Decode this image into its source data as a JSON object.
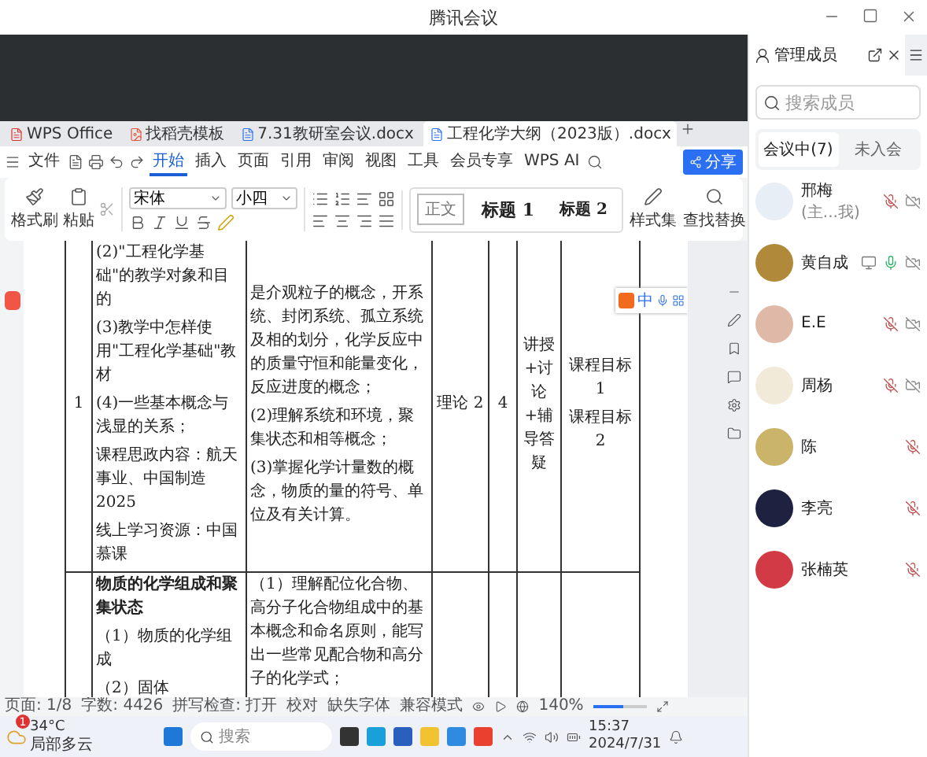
{
  "meeting_window": {
    "title": "腾讯会议"
  },
  "shared_screen": {
    "wps_tabs": [
      {
        "label": "WPS Office",
        "kind": "home",
        "selected": false
      },
      {
        "label": "找稻壳模板",
        "kind": "template",
        "selected": false
      },
      {
        "label": "7.31教研室会议.docx",
        "kind": "doc",
        "selected": false
      },
      {
        "label": "工程化学大纲（2023版）.docx",
        "kind": "doc",
        "selected": true
      }
    ],
    "file_menu": "文件",
    "menu": [
      {
        "label": "开始",
        "selected": true
      },
      {
        "label": "插入",
        "selected": false
      },
      {
        "label": "页面",
        "selected": false
      },
      {
        "label": "引用",
        "selected": false
      },
      {
        "label": "审阅",
        "selected": false
      },
      {
        "label": "视图",
        "selected": false
      },
      {
        "label": "工具",
        "selected": false
      },
      {
        "label": "会员专享",
        "selected": false
      },
      {
        "label": "WPS AI",
        "selected": false
      }
    ],
    "share_button": "分享",
    "ribbon": {
      "format_painter": "格式刷",
      "paste": "粘贴",
      "font": "宋体",
      "size": "小四",
      "styles": [
        {
          "label": "正文",
          "kind": "body",
          "selected": true
        },
        {
          "label": "标题 1",
          "kind": "h1",
          "selected": false
        },
        {
          "label": "标题 2",
          "kind": "h2",
          "selected": false
        }
      ],
      "style_set": "样式集",
      "find_replace": "查找替换"
    },
    "table": {
      "rows": [
        {
          "cells": [
            {
              "paragraphs": [
                "1"
              ]
            },
            {
              "paragraphs": [
                "(2)\"工程化学基础\"的教学对象和目的",
                "(3)教学中怎样使用\"工程化学基础\"教材",
                "(4)一些基本概念与浅显的关系；",
                "课程思政内容：航天事业、中国制造 2025",
                "线上学习资源：中国慕课"
              ]
            },
            {
              "paragraphs": [
                "是介观粒子的概念，开系统、封闭系统、孤立系统及相的划分，化学反应中的质量守恒和能量变化，反应进度的概念；",
                "(2)理解系统和环境，聚集状态和相等概念；",
                "(3)掌握化学计量数的概念，物质的量的符号、单位及有关计算。"
              ]
            },
            {
              "paragraphs": [
                "理论 2"
              ]
            },
            {
              "paragraphs": [
                "4"
              ]
            },
            {
              "paragraphs": [
                "讲授+讨论+辅导答疑"
              ]
            },
            {
              "paragraphs": [
                "课程目标1",
                "课程目标2"
              ]
            }
          ]
        },
        {
          "cells": [
            {},
            {
              "heading": "物质的化学组成和聚集状态",
              "paragraphs": [
                "（1）物质的化学组成",
                "（2）固体"
              ]
            },
            {
              "paragraphs": [
                "（1）理解配位化合物、高分子化合物组成中的基本概念和命名原则，能写出一些常见配合物和高分子的化学式；"
              ]
            },
            {},
            {},
            {},
            {}
          ]
        }
      ]
    },
    "ime_toolbar": {
      "label": "中"
    },
    "status_bar": {
      "items": [
        "页面: 1/8",
        "字数: 4426",
        "拼写检查: 打开",
        "校对",
        "缺失字体",
        "兼容模式"
      ],
      "zoom": "140%",
      "level": 0.55
    }
  },
  "taskbar": {
    "weather_badge": "1",
    "temperature": "34°C",
    "weather": "局部多云",
    "search_placeholder": "搜索",
    "time": "15:37",
    "date": "2024/7/31"
  },
  "members_panel": {
    "title": "管理成员",
    "search_placeholder": "搜索成员",
    "tabs": [
      {
        "label": "会议中(7)",
        "selected": true
      },
      {
        "label": "未入会",
        "selected": false
      }
    ],
    "members": [
      {
        "name": "邢梅",
        "note": "(主...我)",
        "color": "#e8eef6",
        "muted": true,
        "video_off": true,
        "sharing": false
      },
      {
        "name": "黄自成",
        "color": "#b08a3a",
        "muted": false,
        "video_off": true,
        "sharing": true
      },
      {
        "name": "E.E",
        "color": "#e0b8a8",
        "muted": true,
        "video_off": true,
        "sharing": false
      },
      {
        "name": "周杨",
        "color": "#f1ead8",
        "muted": true,
        "video_off": true,
        "sharing": false
      },
      {
        "name": "陈",
        "color": "#c9b46a",
        "muted": true,
        "video_off": false,
        "sharing": false
      },
      {
        "name": "李亮",
        "color": "#1e2240",
        "muted": true,
        "video_off": false,
        "sharing": false
      },
      {
        "name": "张楠英",
        "color": "#d23a45",
        "muted": true,
        "video_off": false,
        "sharing": false
      }
    ]
  }
}
